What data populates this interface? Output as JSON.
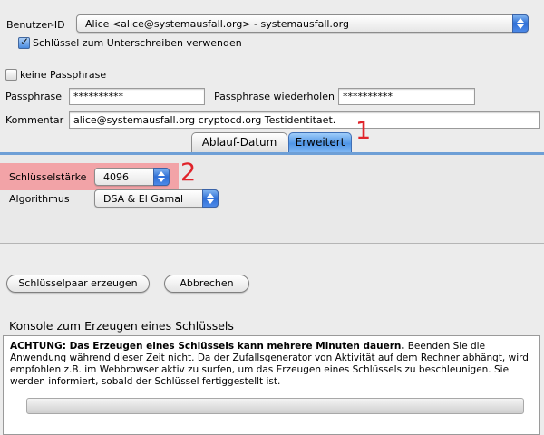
{
  "form": {
    "user_id_label": "Benutzer-ID",
    "user_id_value": "Alice <alice@systemausfall.org> - systemausfall.org",
    "use_for_signing_label": "Schlüssel zum Unterschreiben verwenden",
    "use_for_signing_checked": true,
    "no_passphrase_label": "keine Passphrase",
    "no_passphrase_checked": false,
    "passphrase_label": "Passphrase",
    "passphrase_value": "**********",
    "passphrase_repeat_label": "Passphrase wiederholen",
    "passphrase_repeat_value": "**********",
    "comment_label": "Kommentar",
    "comment_value": "alice@systemausfall.org cryptocd.org Testidentitaet."
  },
  "tabs": [
    {
      "label": "Ablauf-Datum",
      "selected": false
    },
    {
      "label": "Erweitert",
      "selected": true
    }
  ],
  "advanced": {
    "key_strength_label": "Schlüsselstärke",
    "key_strength_value": "4096",
    "algorithm_label": "Algorithmus",
    "algorithm_value": "DSA & El Gamal"
  },
  "buttons": {
    "generate_label": "Schlüsselpaar erzeugen",
    "cancel_label": "Abbrechen"
  },
  "console": {
    "title": "Konsole zum Erzeugen eines Schlüssels",
    "warning_bold": "ACHTUNG: Das Erzeugen eines Schlüssels kann mehrere Minuten dauern.",
    "warning_text": " Beenden Sie die Anwendung während dieser Zeit nicht. Da der Zufallsgenerator von Aktivität auf dem Rechner abhängt, wird empfohlen z.B. im Webbrowser aktiv zu surfen, um das Erzeugen eines Schlüssels zu beschleunigen. Sie werden informiert, sobald der Schlüssel fertiggestellt ist.",
    "progress_fraction": 0
  },
  "annotations": {
    "marker_1": "1",
    "marker_2": "2",
    "color": "#e0232a"
  }
}
